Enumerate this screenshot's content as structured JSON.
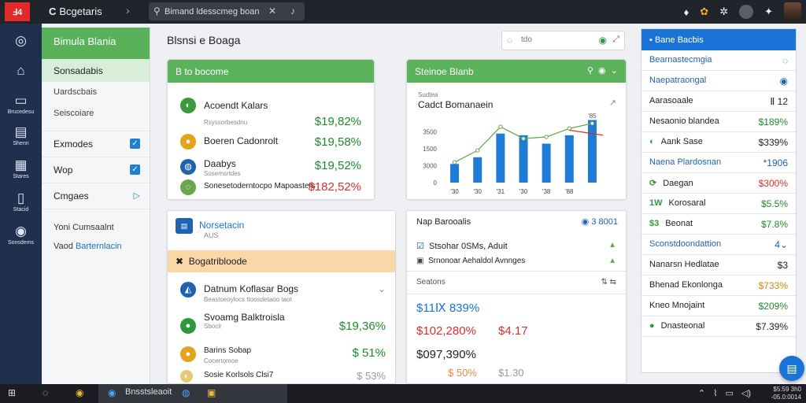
{
  "topbar": {
    "logo": "Ⅎ4",
    "title_mark": "C",
    "title": "Bcgetaris",
    "search_value": "Bimand ldesscmeg boang",
    "colors": {
      "bg": "#20242b",
      "logo": "#e22a2a"
    }
  },
  "leftnav": {
    "items": [
      {
        "icon": "globe-icon",
        "glyph": "◎",
        "label": ""
      },
      {
        "icon": "home-icon",
        "glyph": "⌂",
        "label": ""
      },
      {
        "icon": "monitor-icon",
        "glyph": "▭",
        "label": "Brucedesu"
      },
      {
        "icon": "document-icon",
        "glyph": "▤",
        "label": "Shenn"
      },
      {
        "icon": "grid-icon",
        "glyph": "▦",
        "label": "Stares"
      },
      {
        "icon": "book-icon",
        "glyph": "▯",
        "label": "Stacid"
      },
      {
        "icon": "settings-icon",
        "glyph": "◉",
        "label": "Sonsdems"
      }
    ]
  },
  "sidebar": {
    "header": "Bimula Blania",
    "active": "Sonsadabis",
    "items": [
      "Uardscbais",
      "Seiscoiare"
    ],
    "checks": [
      {
        "label": "Exmodes",
        "checked": true
      },
      {
        "label": "Wop",
        "checked": true
      },
      {
        "label": "Cmgaes",
        "checked": false
      }
    ],
    "foot1": "Yoni Cumsaalnt",
    "foot2_prefix": "Vaod ",
    "foot2_link": "Barternlacin"
  },
  "page": {
    "title": "Blsnsi e Boaga",
    "tools_hint": "tdo"
  },
  "card1": {
    "header": "B to bocome",
    "rows": [
      {
        "name": "Acoendt Kalars",
        "sub": "",
        "value": "$19,82%",
        "color": "green",
        "ic_color": "#3c9a3c",
        "ic": "◐"
      },
      {
        "name": "",
        "sub": "Rsyssorbesdnu",
        "value": "",
        "color": "",
        "ic_color": "",
        "ic": ""
      },
      {
        "name": "Boeren Cadonrolt",
        "sub": "",
        "value": "$19,58%",
        "color": "green",
        "ic_color": "#e2a31d",
        "ic": "●"
      },
      {
        "name": "Daabys",
        "sub": "Sosemsrtdes",
        "value": "$19,52%",
        "color": "green",
        "ic_color": "#1d63b0",
        "ic": "◍"
      },
      {
        "name": "Sonesetoderntocpo Mapoasters",
        "sub": "",
        "value": "$182,52%",
        "color": "red",
        "ic_color": "#6aa84f",
        "ic": "◌"
      }
    ]
  },
  "chart_card": {
    "header": "Steinoe Blanb",
    "subtitle": "Sudtea",
    "title": "Cadct Bomanaein"
  },
  "chart_data": {
    "type": "bar",
    "title": "Cadct Bomanaein",
    "categories": [
      "'30",
      "'30",
      "'31",
      "'30",
      "'38",
      "'88"
    ],
    "values": [
      1100,
      1500,
      3000,
      2900,
      2400,
      2900,
      3800
    ],
    "bar_labels": [
      "'30",
      "'30",
      "'31",
      "'30",
      "'38",
      "'88"
    ],
    "series": [
      {
        "name": "",
        "values": [
          1100,
          1500,
          2900,
          2800,
          2300,
          2800,
          3700
        ]
      }
    ],
    "line_values": [
      1200,
      1900,
      3300,
      2600,
      2700,
      3200,
      3500
    ],
    "red_line_values": [
      3100,
      2800
    ],
    "yticks": [
      0,
      1000,
      2000,
      3000
    ],
    "ytick_labels": [
      "0",
      "3000",
      "1500",
      "3500"
    ],
    "ylim": [
      0,
      4000
    ],
    "annotation": "'85",
    "colors": {
      "bar": "#1e7bd6",
      "line": "#6aa84f",
      "accent": "#d9302b"
    }
  },
  "card3": {
    "header": "Norsetacin",
    "sub": "AUS",
    "orange_label": "Bogatribloode",
    "rows": [
      {
        "name": "Datnum Koflasar Bogs",
        "sub": "Beastoeoylocs ttoosdetaoo taot",
        "value": "",
        "color": "",
        "ic_color": "#1d63b0",
        "ic": "◭"
      },
      {
        "name": "Svoamg Balktroisla",
        "sub": "Sboclr",
        "value": "$19,36%",
        "color": "green",
        "ic_color": "#2c9a3c",
        "ic": "●"
      },
      {
        "name": "Barins Sobap",
        "sub": "Cocertomoe",
        "value": "$ 51%",
        "color": "green",
        "ic_color": "#e2a31d",
        "ic": "●"
      },
      {
        "name": "Sosie Korlsols Clsi7",
        "sub": "",
        "value": "$ 53%",
        "color": "grey",
        "ic_color": "#e8c877",
        "ic": "◐"
      }
    ]
  },
  "card4": {
    "title": "Nap Barooalis",
    "control": "3 8001",
    "line1": "Stsohar 0SMs, Aduit",
    "line2": "Srnonoar Aehaldol Avnnges",
    "section": "Seatons",
    "values": [
      {
        "text": "$11Ⅸ 839%",
        "color": "blue"
      },
      {
        "text": "$102,280%",
        "color": "red"
      },
      {
        "text": "$4.17",
        "color": "red"
      },
      {
        "text": "$097,390%",
        "color": "dark"
      },
      {
        "text": "$ 50%",
        "color": "orange"
      },
      {
        "text": "$1.30",
        "color": "grey"
      }
    ]
  },
  "rpanel": {
    "header": "Bane Bacbis",
    "rows": [
      {
        "label": "Bearnastecmgia",
        "value": "◌",
        "color": "blue",
        "icon": ""
      },
      {
        "label": "Naepatraongal",
        "value": "◉",
        "color": "blue",
        "icon": ""
      },
      {
        "label": "Aarasoaale",
        "value": "Ⅱ 12",
        "color": "dark",
        "icon": ""
      },
      {
        "label": "Nesaonio blandea",
        "value": "$189%",
        "color": "green",
        "icon": ""
      },
      {
        "label": "Aank Sase",
        "value": "$339%",
        "color": "dark",
        "icon": "◐"
      },
      {
        "label": "Naena Plardosnan",
        "value": "*1906",
        "color": "blue",
        "icon": ""
      },
      {
        "label": "Daegan",
        "value": "$300%",
        "color": "red",
        "icon": "⟳"
      },
      {
        "label": "Korosaral",
        "value": "$5.5%",
        "color": "green",
        "icon": "1W"
      },
      {
        "label": "Beonat",
        "value": "$7.8%",
        "color": "green",
        "icon": "$3"
      },
      {
        "label": "Sconstdoondattion",
        "value": "4⌄",
        "color": "blue",
        "icon": ""
      },
      {
        "label": "Nanarsn Hedlatae",
        "value": "$3",
        "color": "dark",
        "icon": ""
      },
      {
        "label": "Bhenad Ekonlonga",
        "value": "$733%",
        "color": "gold",
        "icon": ""
      },
      {
        "label": "Kneo Mnojaint",
        "value": "$209%",
        "color": "green",
        "icon": ""
      },
      {
        "label": "Dnasteonal",
        "value": "$7.39%",
        "color": "dark",
        "icon": "●"
      }
    ],
    "accent": "#1a73d6"
  },
  "taskbar": {
    "app_label": "Bnsstsleaoit",
    "clock1": "$5:59 3h0",
    "clock2": "-05.0:0014"
  }
}
